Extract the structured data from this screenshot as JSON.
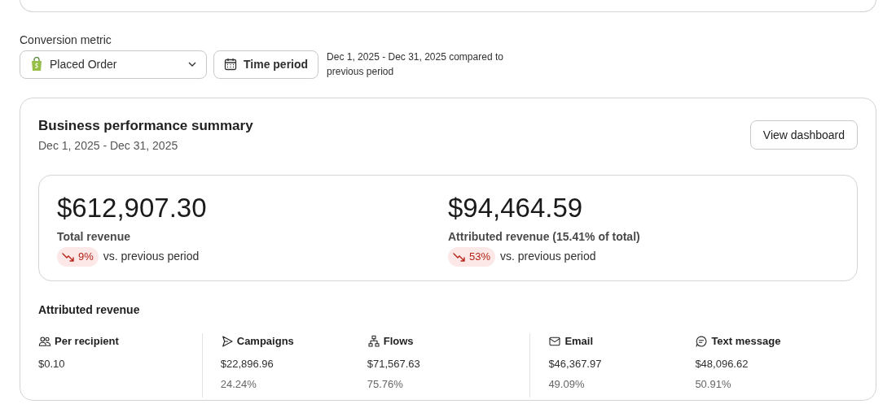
{
  "conversion_metric": {
    "label": "Conversion metric",
    "value": "Placed Order"
  },
  "time_period": {
    "label": "Time period",
    "description": "Dec 1, 2025 - Dec 31, 2025 compared to previous period"
  },
  "summary": {
    "title": "Business performance summary",
    "date_range": "Dec 1, 2025 - Dec 31, 2025",
    "button": "View dashboard",
    "kpis": [
      {
        "value": "$612,907.30",
        "label": "Total revenue",
        "change": "9%",
        "decrease": true,
        "comparison": "vs. previous period"
      },
      {
        "value": "$94,464.59",
        "label": "Attributed revenue (15.41% of total)",
        "change": "53%",
        "decrease": true,
        "comparison": "vs. previous period"
      }
    ],
    "attributed": {
      "title": "Attributed revenue",
      "groups": [
        [
          {
            "kind": "people",
            "label": "Per recipient",
            "value": "$0.10"
          }
        ],
        [
          {
            "kind": "send",
            "label": "Campaigns",
            "value": "$22,896.96",
            "share": "24.24%"
          },
          {
            "kind": "flow",
            "label": "Flows",
            "value": "$71,567.63",
            "share": "75.76%"
          }
        ],
        [
          {
            "kind": "mail",
            "label": "Email",
            "value": "$46,367.97",
            "share": "49.09%"
          },
          {
            "kind": "chat",
            "label": "Text message",
            "value": "$48,096.62",
            "share": "50.91%"
          }
        ]
      ]
    }
  }
}
